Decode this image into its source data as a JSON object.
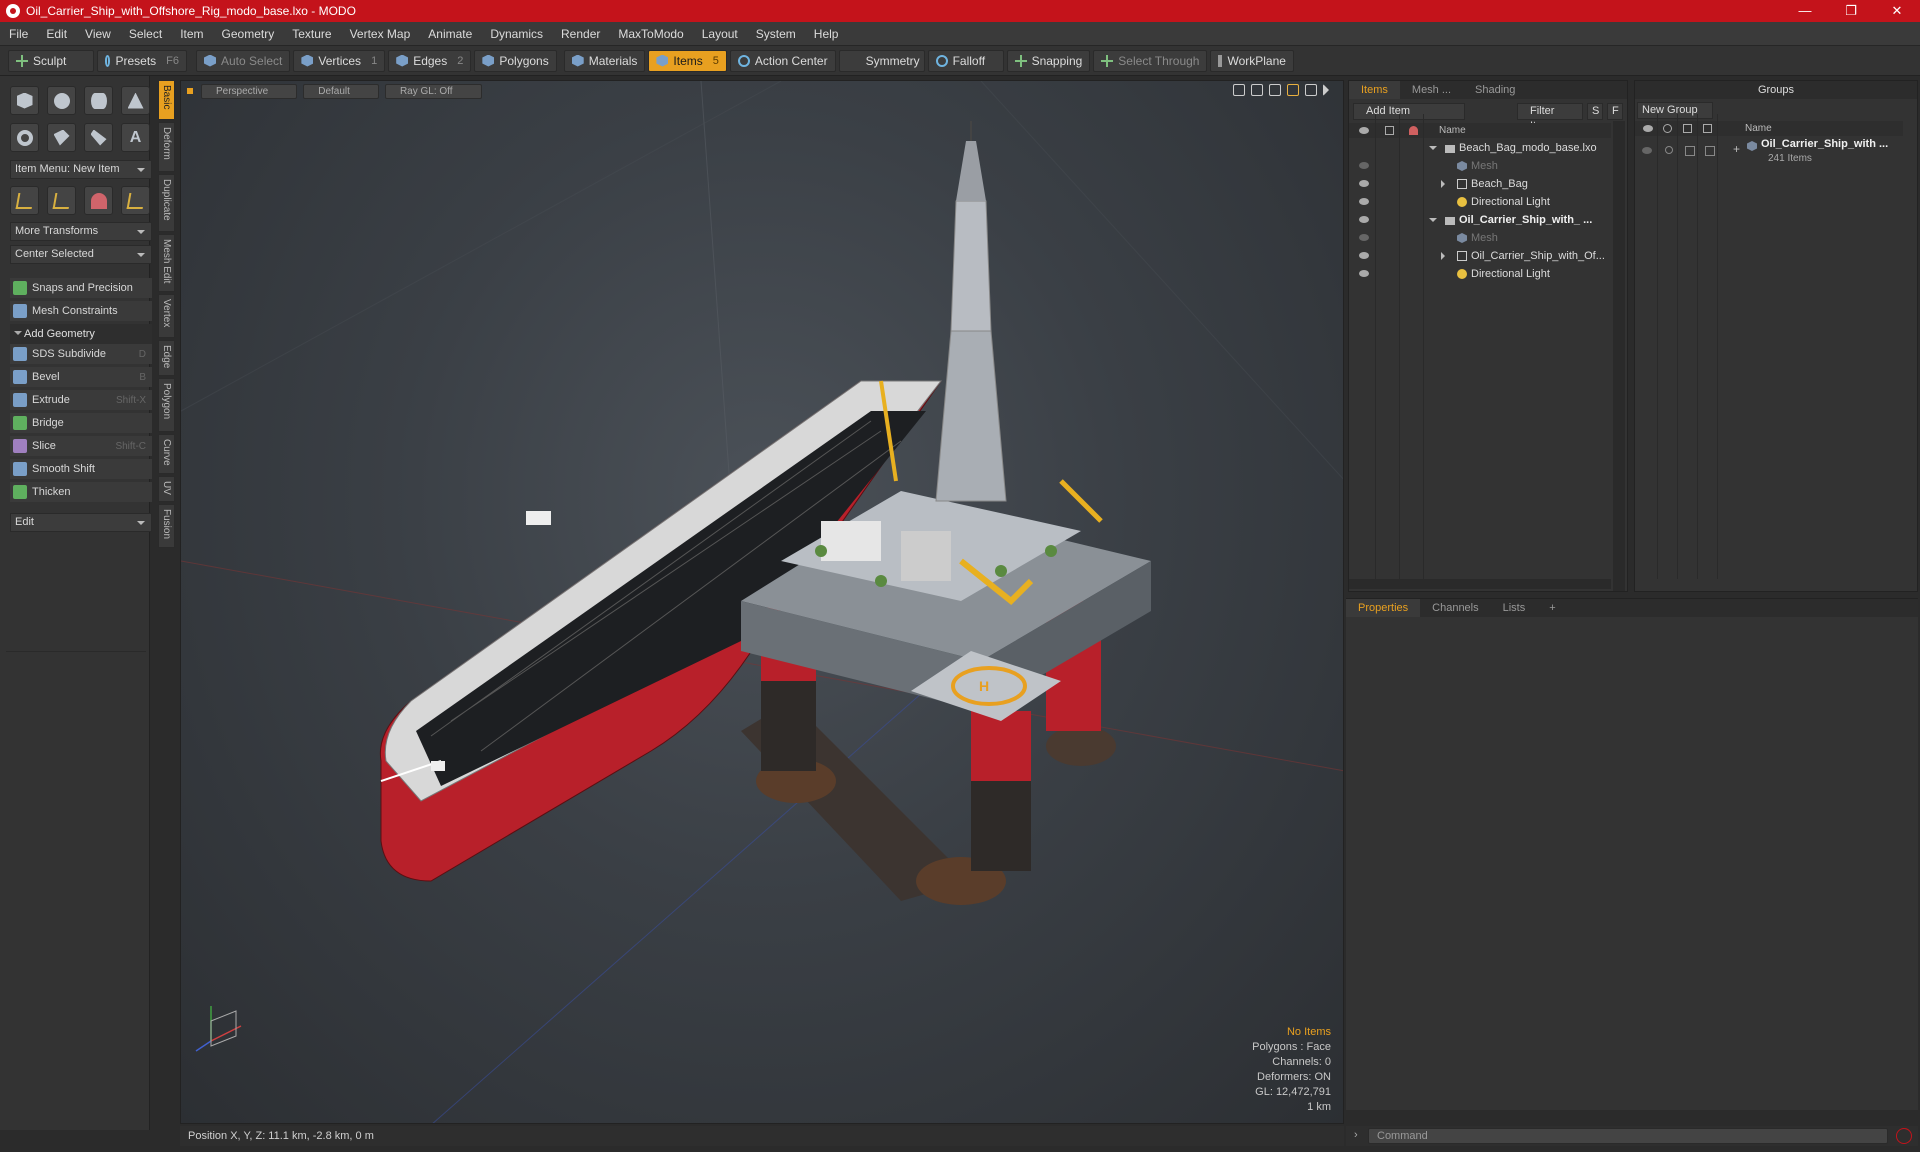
{
  "window": {
    "title": "Oil_Carrier_Ship_with_Offshore_Rig_modo_base.lxo - MODO",
    "min": "—",
    "max": "❐",
    "close": "✕"
  },
  "menu": [
    "File",
    "Edit",
    "View",
    "Select",
    "Item",
    "Geometry",
    "Texture",
    "Vertex Map",
    "Animate",
    "Dynamics",
    "Render",
    "MaxToModo",
    "Layout",
    "System",
    "Help"
  ],
  "toolbar": {
    "sculpt": "Sculpt",
    "presets": "Presets",
    "presets_key": "F6",
    "auto_select": "Auto Select",
    "vertices": "Vertices",
    "vertices_n": "1",
    "edges": "Edges",
    "edges_n": "2",
    "polygons": "Polygons",
    "materials": "Materials",
    "items": "Items",
    "items_n": "5",
    "action_center": "Action Center",
    "symmetry": "Symmetry",
    "falloff": "Falloff",
    "snapping": "Snapping",
    "select_through": "Select Through",
    "workplane": "WorkPlane"
  },
  "left": {
    "item_menu": "Item Menu: New Item",
    "more_transforms": "More Transforms",
    "center_selected": "Center Selected",
    "snaps": "Snaps and Precision",
    "mesh_constraints": "Mesh Constraints",
    "add_geometry": "Add Geometry",
    "tools": [
      {
        "label": "SDS Subdivide",
        "key": "D"
      },
      {
        "label": "Bevel",
        "key": "B"
      },
      {
        "label": "Extrude",
        "key": "Shift-X"
      },
      {
        "label": "Bridge",
        "key": ""
      },
      {
        "label": "Slice",
        "key": "Shift-C"
      },
      {
        "label": "Smooth Shift",
        "key": ""
      },
      {
        "label": "Thicken",
        "key": ""
      }
    ],
    "edit": "Edit",
    "vtabs": [
      "Basic",
      "Deform",
      "Duplicate",
      "Mesh Edit",
      "Vertex",
      "Edge",
      "Polygon",
      "Curve",
      "UV",
      "Fusion"
    ]
  },
  "viewport": {
    "perspective": "Perspective",
    "default": "Default",
    "raygl": "Ray GL: Off",
    "info": {
      "no_items": "No Items",
      "polygons": "Polygons : Face",
      "channels": "Channels: 0",
      "deformers": "Deformers: ON",
      "gl": "GL: 12,472,791",
      "scale": "1 km"
    }
  },
  "status": {
    "position": "Position X, Y, Z:  11.1 km, -2.8 km, 0 m"
  },
  "items_panel": {
    "tabs": [
      "Items",
      "Mesh ...",
      "Shading"
    ],
    "add_item": "Add Item",
    "filter_items": "Filter Items",
    "s": "S",
    "f": "F",
    "col_name": "Name",
    "rows": [
      {
        "label": "Beach_Bag_modo_base.lxo",
        "type": "scene",
        "indent": 0,
        "expand": "down",
        "style": ""
      },
      {
        "label": "Mesh",
        "type": "mesh",
        "indent": 1,
        "expand": "",
        "style": "dim"
      },
      {
        "label": "Beach_Bag",
        "type": "loc",
        "indent": 1,
        "expand": "right",
        "style": ""
      },
      {
        "label": "Directional Light",
        "type": "light",
        "indent": 1,
        "expand": "",
        "style": ""
      },
      {
        "label": "Oil_Carrier_Ship_with_ ...",
        "type": "scene",
        "indent": 0,
        "expand": "down",
        "style": "bold"
      },
      {
        "label": "Mesh",
        "type": "mesh",
        "indent": 1,
        "expand": "",
        "style": "dim"
      },
      {
        "label": "Oil_Carrier_Ship_with_Of...",
        "type": "loc",
        "indent": 1,
        "expand": "right",
        "style": ""
      },
      {
        "label": "Directional Light",
        "type": "light",
        "indent": 1,
        "expand": "",
        "style": ""
      }
    ]
  },
  "groups_panel": {
    "title": "Groups",
    "new_group": "New Group",
    "col_name": "Name",
    "group_name": "Oil_Carrier_Ship_with ...",
    "group_count": "241 Items"
  },
  "props_panel": {
    "tabs": [
      "Properties",
      "Channels",
      "Lists"
    ],
    "add": "+"
  },
  "command": {
    "placeholder": "Command"
  },
  "colors": {
    "titlebar": "#c4131b",
    "accent": "#e8a020",
    "hull_red": "#b8202a"
  }
}
